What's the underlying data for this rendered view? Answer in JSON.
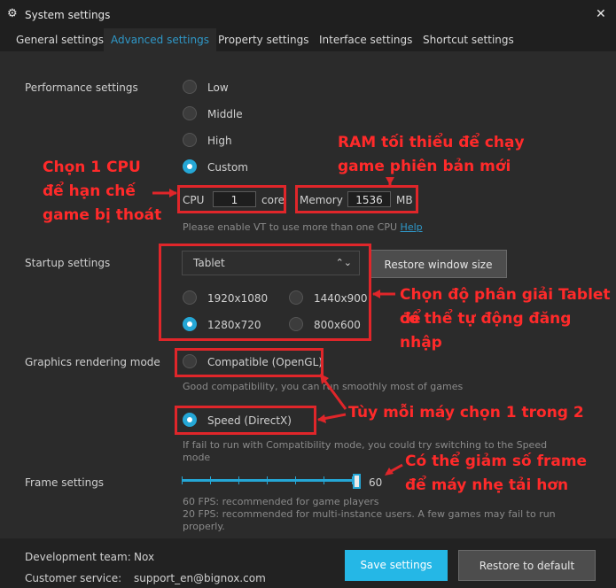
{
  "window": {
    "title": "System settings"
  },
  "tabs": [
    {
      "label": "General settings"
    },
    {
      "label": "Advanced settings"
    },
    {
      "label": "Property settings"
    },
    {
      "label": "Interface settings"
    },
    {
      "label": "Shortcut settings"
    }
  ],
  "performance": {
    "label": "Performance settings",
    "options": [
      "Low",
      "Middle",
      "High",
      "Custom"
    ],
    "selected": "Custom",
    "cpu_label": "CPU",
    "cpu_value": "1",
    "cpu_unit": "core",
    "memory_label": "Memory",
    "memory_value": "1536",
    "memory_unit": "MB",
    "vt_hint": "Please enable VT to use more than one CPU",
    "help_link": "Help"
  },
  "startup": {
    "label": "Startup settings",
    "mode_selected": "Tablet",
    "restore_window_button": "Restore window size",
    "resolutions": [
      "1920x1080",
      "1440x900",
      "1280x720",
      "800x600"
    ],
    "resolution_selected": "1280x720"
  },
  "graphics": {
    "label": "Graphics rendering mode",
    "compatible_label": "Compatible (OpenGL)",
    "compatible_hint": "Good compatibility, you can run smoothly most of games",
    "speed_label": "Speed (DirectX)",
    "speed_hint_line1": "If fail to run with Compatibility mode, you could try switching to the Speed",
    "speed_hint_line2": "mode",
    "selected": "Speed (DirectX)"
  },
  "frame": {
    "label": "Frame settings",
    "value": "60",
    "fps_level": 1.0,
    "hint_line1": "60 FPS: recommended for game players",
    "hint_line2": "20 FPS: recommended for multi-instance users. A few games may fail to run",
    "hint_line3": "properly."
  },
  "footer": {
    "dev_label": "Development team:",
    "dev_value": "Nox",
    "cs_label": "Customer service:",
    "cs_value": "support_en@bignox.com",
    "save_button": "Save settings",
    "restore_default_button": "Restore to default"
  },
  "annotations": {
    "cpu_note_1": "Chọn 1 CPU",
    "cpu_note_2": "để hạn chế",
    "cpu_note_3": "game bị thoát",
    "ram_note_1": "RAM tối thiểu để chạy",
    "ram_note_2": "game phiên bản mới",
    "res_note_1": "Chọn độ phân giải Tablet để",
    "res_note_2": "có thể tự động đăng nhập",
    "gfx_note": "Tùy mỗi máy chọn 1 trong 2",
    "frame_note_1": "Có thể giảm số frame",
    "frame_note_2": "để máy nhẹ tải hơn"
  },
  "colors": {
    "accent": "#25a7d6",
    "annotation_red": "#e0262a",
    "save_button_bg": "#25b7e6"
  },
  "icons": {
    "settings": "gear-icon",
    "close": "close-icon",
    "dropdown": "chevron-updown-icon"
  }
}
